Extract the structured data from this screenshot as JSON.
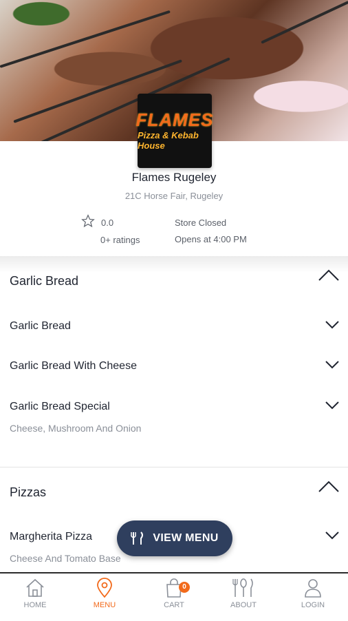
{
  "store": {
    "logo_text": [
      "FLAMES",
      "Pizza & Kebab House"
    ],
    "name": "Flames Rugeley",
    "address": "21C Horse Fair, Rugeley",
    "rating": "0.0",
    "rating_count": "0+ ratings",
    "status": "Store Closed",
    "opens": "Opens at 4:00 PM"
  },
  "categories": [
    {
      "name": "Garlic Bread",
      "expanded": true,
      "items": [
        {
          "name": "Garlic Bread",
          "description": ""
        },
        {
          "name": "Garlic Bread With Cheese",
          "description": ""
        },
        {
          "name": "Garlic Bread Special",
          "description": "Cheese, Mushroom And Onion"
        }
      ]
    },
    {
      "name": "Pizzas",
      "expanded": true,
      "items": [
        {
          "name": "Margherita Pizza",
          "description": "Cheese And Tomato Base"
        }
      ]
    }
  ],
  "view_menu": {
    "label": "VIEW MENU",
    "icon": "cutlery-icon"
  },
  "tabbar": {
    "items": [
      {
        "label": "HOME",
        "icon": "home-icon",
        "active": false
      },
      {
        "label": "MENU",
        "icon": "location-pin-icon",
        "active": true
      },
      {
        "label": "CART",
        "icon": "bag-icon",
        "active": false,
        "badge": "0"
      },
      {
        "label": "ABOUT",
        "icon": "cutlery-icon",
        "active": false
      },
      {
        "label": "LOGIN",
        "icon": "user-icon",
        "active": false
      }
    ]
  },
  "colors": {
    "accent": "#f26a1b",
    "navy": "#2f3f5e",
    "text": "#1f2430",
    "muted": "#8a8f98"
  }
}
